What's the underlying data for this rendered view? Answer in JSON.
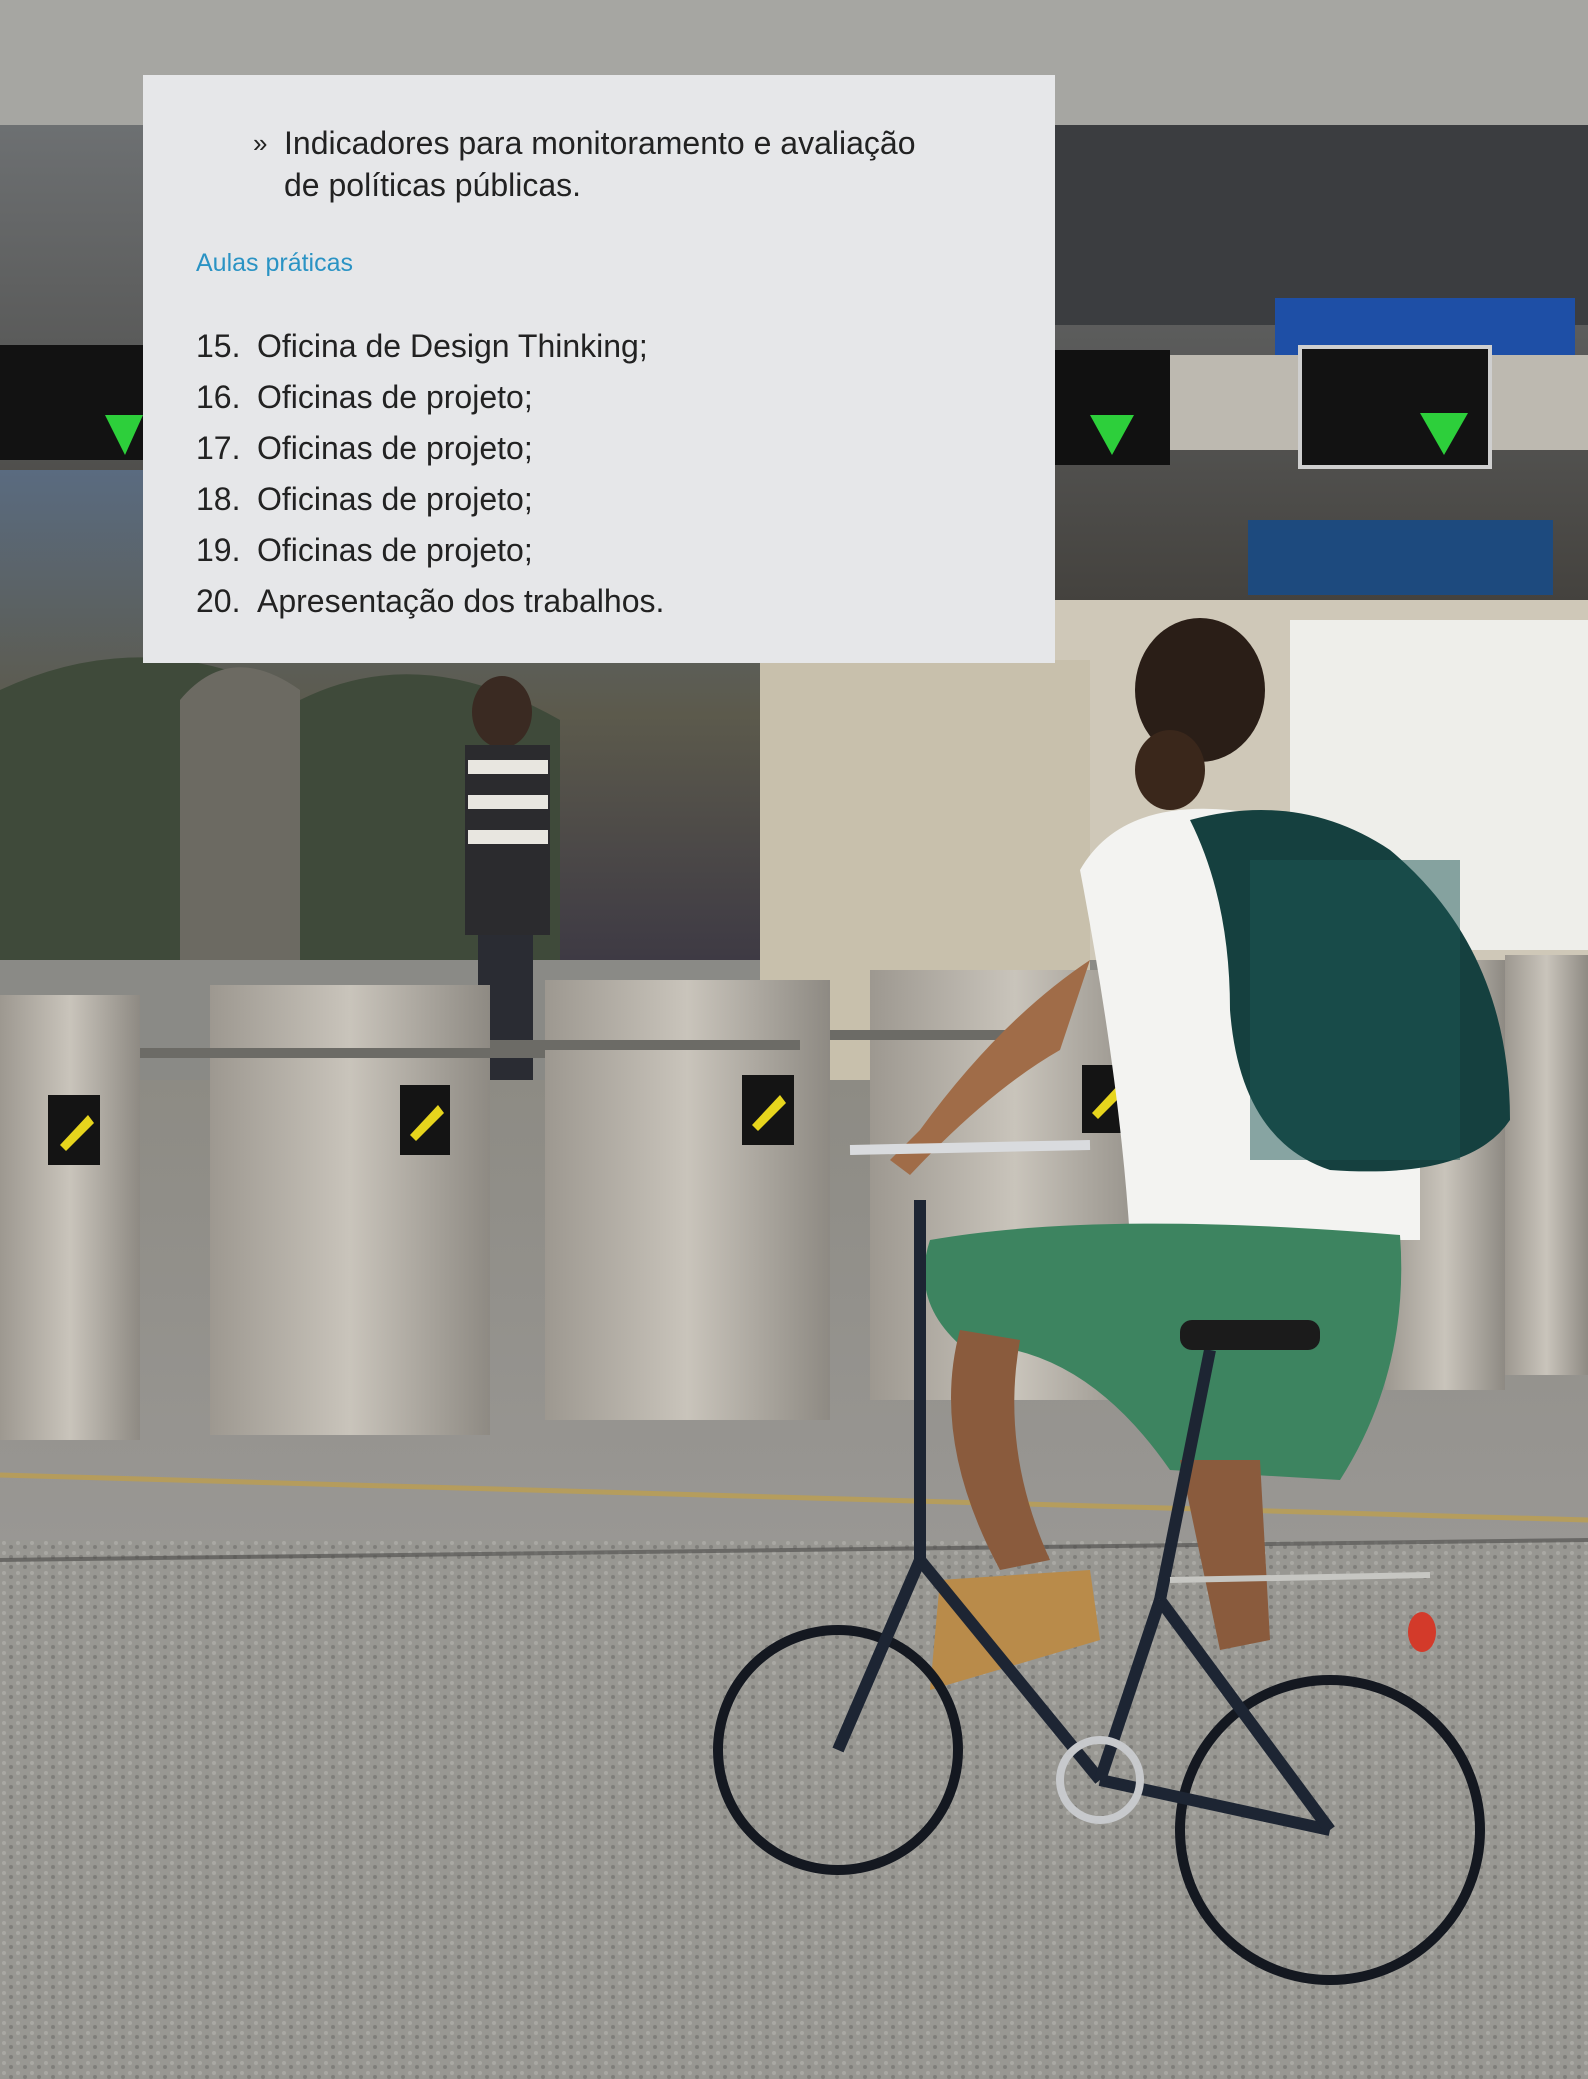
{
  "intro_bullet": {
    "marker": "»",
    "text": "Indicadores para monitoramento e avaliação de políticas públicas."
  },
  "section": {
    "heading": "Aulas práticas",
    "heading_color": "#2a93c4"
  },
  "lessons": [
    {
      "number": "15.",
      "title": "Oficina de Design Thinking;"
    },
    {
      "number": "16.",
      "title": "Oficinas de projeto;"
    },
    {
      "number": "17.",
      "title": "Oficinas de projeto;"
    },
    {
      "number": "18.",
      "title": "Oficinas de projeto;"
    },
    {
      "number": "19.",
      "title": "Oficinas de projeto;"
    },
    {
      "number": "20.",
      "title": "Apresentação dos trabalhos."
    }
  ],
  "photo": {
    "subject": "cyclist-at-station-turnstiles"
  }
}
